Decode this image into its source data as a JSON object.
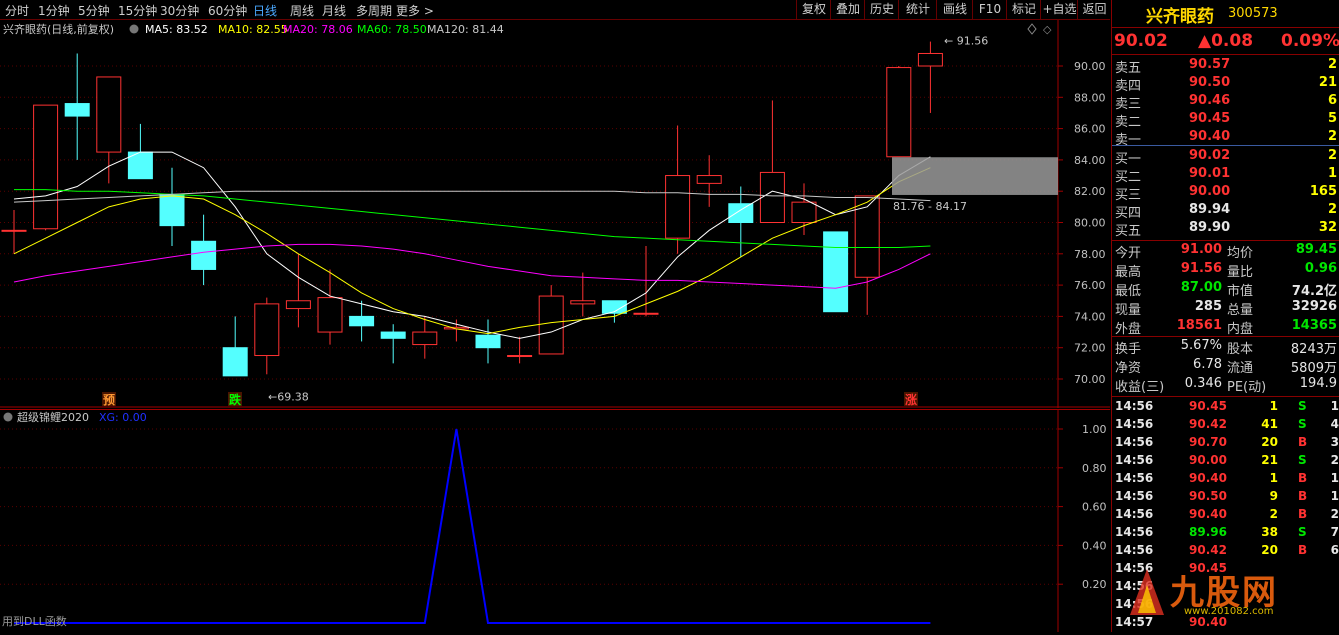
{
  "toolbar": {
    "tabs": [
      "分时",
      "1分钟",
      "5分钟",
      "15分钟",
      "30分钟",
      "60分钟",
      "日线",
      "周线",
      "月线",
      "多周期",
      "更多 >"
    ],
    "active_tab": "日线",
    "buttons": [
      "复权",
      "叠加",
      "历史",
      "统计",
      "画线",
      "F10",
      "标记",
      "+自选",
      "返回"
    ]
  },
  "main_chart": {
    "title": "兴齐眼药(日线,前复权)",
    "ma_legend": [
      {
        "label": "MA5: 83.52",
        "color": "#ffffff"
      },
      {
        "label": "MA10: 82.55",
        "color": "#ffff00"
      },
      {
        "label": "MA20: 78.06",
        "color": "#ff00ff"
      },
      {
        "label": "MA60: 78.50",
        "color": "#00ff00"
      },
      {
        "label": "MA120: 81.44",
        "color": "#c8c8c8"
      }
    ],
    "high_marker": "91.56",
    "low_marker": "←69.38",
    "range_label": "81.76 - 84.17",
    "signals": [
      {
        "text": "预",
        "color": "#ff9933"
      },
      {
        "text": "跌",
        "color": "#00ff00"
      },
      {
        "text": "涨",
        "color": "#ff3333"
      }
    ],
    "y_ticks": [
      "90.00",
      "88.00",
      "86.00",
      "84.00",
      "82.00",
      "80.00",
      "78.00",
      "76.00",
      "74.00",
      "72.00",
      "70.00"
    ]
  },
  "chart_data": [
    {
      "type": "candlestick",
      "title": "兴齐眼药(日线,前复权)",
      "ylim": [
        69,
        93
      ],
      "candles": [
        {
          "o": 79.5,
          "c": 79.5,
          "h": 80.8,
          "l": 78.0
        },
        {
          "o": 79.6,
          "c": 87.5,
          "h": 87.5,
          "l": 79.5
        },
        {
          "o": 87.6,
          "c": 86.8,
          "h": 90.8,
          "l": 84.0
        },
        {
          "o": 84.5,
          "c": 89.3,
          "h": 89.3,
          "l": 82.5
        },
        {
          "o": 84.5,
          "c": 82.8,
          "h": 86.3,
          "l": 82.8
        },
        {
          "o": 81.8,
          "c": 79.8,
          "h": 83.5,
          "l": 78.5
        },
        {
          "o": 78.8,
          "c": 77.0,
          "h": 80.5,
          "l": 76.0
        },
        {
          "o": 72.0,
          "c": 70.2,
          "h": 74.0,
          "l": 70.2
        },
        {
          "o": 71.5,
          "c": 74.8,
          "h": 75.2,
          "l": 70.3
        },
        {
          "o": 74.5,
          "c": 75.0,
          "h": 78.0,
          "l": 73.3
        },
        {
          "o": 73.0,
          "c": 75.2,
          "h": 77.0,
          "l": 72.2
        },
        {
          "o": 74.0,
          "c": 73.4,
          "h": 75.0,
          "l": 72.4
        },
        {
          "o": 73.0,
          "c": 72.6,
          "h": 73.5,
          "l": 71.0
        },
        {
          "o": 72.2,
          "c": 73.0,
          "h": 74.0,
          "l": 71.3
        },
        {
          "o": 73.2,
          "c": 73.3,
          "h": 73.8,
          "l": 72.4
        },
        {
          "o": 72.8,
          "c": 72.0,
          "h": 73.8,
          "l": 71.0
        },
        {
          "o": 71.5,
          "c": 71.5,
          "h": 72.7,
          "l": 71.0
        },
        {
          "o": 71.6,
          "c": 75.3,
          "h": 76.0,
          "l": 71.6
        },
        {
          "o": 74.8,
          "c": 75.0,
          "h": 76.8,
          "l": 74.0
        },
        {
          "o": 75.0,
          "c": 74.2,
          "h": 75.0,
          "l": 73.6
        },
        {
          "o": 74.2,
          "c": 74.2,
          "h": 78.5,
          "l": 74.0
        },
        {
          "o": 79.0,
          "c": 83.0,
          "h": 86.2,
          "l": 78.0
        },
        {
          "o": 82.5,
          "c": 83.0,
          "h": 84.3,
          "l": 81.0
        },
        {
          "o": 81.2,
          "c": 80.0,
          "h": 82.3,
          "l": 77.8
        },
        {
          "o": 80.0,
          "c": 83.2,
          "h": 87.8,
          "l": 80.0
        },
        {
          "o": 80.0,
          "c": 81.3,
          "h": 82.5,
          "l": 79.2
        },
        {
          "o": 79.4,
          "c": 74.3,
          "h": 79.4,
          "l": 74.3
        },
        {
          "o": 76.5,
          "c": 81.7,
          "h": 81.7,
          "l": 74.1
        },
        {
          "o": 84.2,
          "c": 89.9,
          "h": 90.0,
          "l": 84.2
        },
        {
          "o": 90.0,
          "c": 90.8,
          "h": 91.56,
          "l": 87.0
        }
      ],
      "series": [
        {
          "name": "MA5",
          "color": "#ffffff",
          "values": [
            81.5,
            81.7,
            82.3,
            83.6,
            84.5,
            84.5,
            83.5,
            81.0,
            78.0,
            76.5,
            75.3,
            74.8,
            74.3,
            74.0,
            73.5,
            73.0,
            72.6,
            73.0,
            73.8,
            74.3,
            75.5,
            77.8,
            79.5,
            80.8,
            82.0,
            81.5,
            80.5,
            81.0,
            83.0,
            84.2
          ]
        },
        {
          "name": "MA10",
          "color": "#ffff00",
          "values": [
            78.0,
            79.0,
            80.0,
            81.0,
            81.5,
            81.7,
            81.5,
            80.5,
            79.3,
            78.0,
            76.8,
            75.5,
            74.5,
            73.8,
            73.2,
            72.9,
            73.3,
            73.6,
            73.8,
            74.0,
            74.8,
            75.6,
            76.6,
            77.8,
            79.0,
            79.8,
            80.5,
            81.3,
            82.6,
            83.5
          ]
        },
        {
          "name": "MA20",
          "color": "#ff00ff",
          "values": [
            76.2,
            76.6,
            76.9,
            77.2,
            77.5,
            77.8,
            78.1,
            78.3,
            78.5,
            78.6,
            78.6,
            78.5,
            78.3,
            78.0,
            77.6,
            77.2,
            76.9,
            76.6,
            76.5,
            76.4,
            76.3,
            76.3,
            76.2,
            76.1,
            76.0,
            75.9,
            75.8,
            76.2,
            77.0,
            78.0
          ]
        },
        {
          "name": "MA60",
          "color": "#00ff00",
          "values": [
            82.1,
            82.1,
            82.0,
            82.0,
            81.9,
            81.8,
            81.7,
            81.5,
            81.3,
            81.1,
            80.9,
            80.7,
            80.5,
            80.3,
            80.1,
            79.9,
            79.7,
            79.5,
            79.3,
            79.1,
            79.0,
            78.9,
            78.8,
            78.7,
            78.6,
            78.5,
            78.4,
            78.4,
            78.4,
            78.5
          ]
        },
        {
          "name": "MA120",
          "color": "#c8c8c8",
          "values": [
            81.3,
            81.4,
            81.5,
            81.6,
            81.7,
            81.8,
            81.9,
            82.0,
            82.0,
            82.0,
            82.0,
            82.0,
            82.0,
            82.0,
            82.0,
            82.0,
            82.0,
            82.0,
            82.0,
            82.0,
            81.9,
            81.9,
            81.8,
            81.8,
            81.7,
            81.7,
            81.6,
            81.6,
            81.5,
            81.4
          ]
        }
      ]
    },
    {
      "type": "line",
      "title": "超级锦鲤2020",
      "legend": "XG: 0.00",
      "ylim": [
        0,
        1.1
      ],
      "y_ticks": [
        "1.00",
        "0.80",
        "0.60",
        "0.40",
        "0.20"
      ],
      "series": [
        {
          "name": "XG",
          "color": "#0000ff",
          "values": [
            0,
            0,
            0,
            0,
            0,
            0,
            0,
            0,
            0,
            0,
            0,
            0,
            0,
            0,
            1,
            0,
            0,
            0,
            0,
            0,
            0,
            0,
            0,
            0,
            0,
            0,
            0,
            0,
            0,
            0
          ]
        }
      ]
    }
  ],
  "sub_chart_footer": "用到DLL函数",
  "quote": {
    "name": "兴齐眼药",
    "code": "300573",
    "price": "90.02",
    "change": "▲0.08",
    "change_pct": "0.09%",
    "asks": [
      {
        "label": "卖五",
        "price": "90.57",
        "vol": "2"
      },
      {
        "label": "卖四",
        "price": "90.50",
        "vol": "21"
      },
      {
        "label": "卖三",
        "price": "90.46",
        "vol": "6"
      },
      {
        "label": "卖二",
        "price": "90.45",
        "vol": "5"
      },
      {
        "label": "卖一",
        "price": "90.40",
        "vol": "2"
      }
    ],
    "bids": [
      {
        "label": "买一",
        "price": "90.02",
        "vol": "2"
      },
      {
        "label": "买二",
        "price": "90.01",
        "vol": "1"
      },
      {
        "label": "买三",
        "price": "90.00",
        "vol": "165"
      },
      {
        "label": "买四",
        "price": "89.94",
        "vol": "2"
      },
      {
        "label": "买五",
        "price": "89.90",
        "vol": "32"
      }
    ],
    "stats1": [
      {
        "l1": "今开",
        "v1": "91.00",
        "c1": "red",
        "l2": "均价",
        "v2": "89.45",
        "c2": "green"
      },
      {
        "l1": "最高",
        "v1": "91.56",
        "c1": "red",
        "l2": "量比",
        "v2": "0.96",
        "c2": "green"
      },
      {
        "l1": "最低",
        "v1": "87.00",
        "c1": "green",
        "l2": "市值",
        "v2": "74.2亿",
        "c2": "white"
      },
      {
        "l1": "现量",
        "v1": "285",
        "c1": "white",
        "l2": "总量",
        "v2": "32926",
        "c2": "white"
      },
      {
        "l1": "外盘",
        "v1": "18561",
        "c1": "red",
        "l2": "内盘",
        "v2": "14365",
        "c2": "green"
      }
    ],
    "stats2": [
      {
        "l1": "换手",
        "v1": "5.67%",
        "l2": "股本",
        "v2": "8243万"
      },
      {
        "l1": "净资",
        "v1": "6.78",
        "l2": "流通",
        "v2": "5809万"
      },
      {
        "l1": "收益(三)",
        "v1": "0.346",
        "l2": "PE(动)",
        "v2": "194.9"
      }
    ],
    "trades": [
      {
        "time": "14:56",
        "price": "90.45",
        "pc": "red",
        "vol": "1",
        "side": "S",
        "n": "1"
      },
      {
        "time": "14:56",
        "price": "90.42",
        "pc": "red",
        "vol": "41",
        "side": "S",
        "n": "4"
      },
      {
        "time": "14:56",
        "price": "90.70",
        "pc": "red",
        "vol": "20",
        "side": "B",
        "n": "3"
      },
      {
        "time": "14:56",
        "price": "90.00",
        "pc": "red",
        "vol": "21",
        "side": "S",
        "n": "2"
      },
      {
        "time": "14:56",
        "price": "90.40",
        "pc": "red",
        "vol": "1",
        "side": "B",
        "n": "1"
      },
      {
        "time": "14:56",
        "price": "90.50",
        "pc": "red",
        "vol": "9",
        "side": "B",
        "n": "1"
      },
      {
        "time": "14:56",
        "price": "90.40",
        "pc": "red",
        "vol": "2",
        "side": "B",
        "n": "2"
      },
      {
        "time": "14:56",
        "price": "89.96",
        "pc": "green",
        "vol": "38",
        "side": "S",
        "n": "7"
      },
      {
        "time": "14:56",
        "price": "90.42",
        "pc": "red",
        "vol": "20",
        "side": "B",
        "n": "6"
      },
      {
        "time": "14:56",
        "price": "90.45",
        "pc": "red",
        "vol": "",
        "side": "",
        "n": ""
      },
      {
        "time": "14:56",
        "price": "",
        "pc": "red",
        "vol": "",
        "side": "",
        "n": ""
      },
      {
        "time": "14:56",
        "price": "",
        "pc": "red",
        "vol": "",
        "side": "",
        "n": ""
      },
      {
        "time": "14:57",
        "price": "90.40",
        "pc": "red",
        "vol": "",
        "side": "",
        "n": ""
      }
    ]
  },
  "watermark": {
    "text": "九股网",
    "sub": "www.201082.com"
  }
}
